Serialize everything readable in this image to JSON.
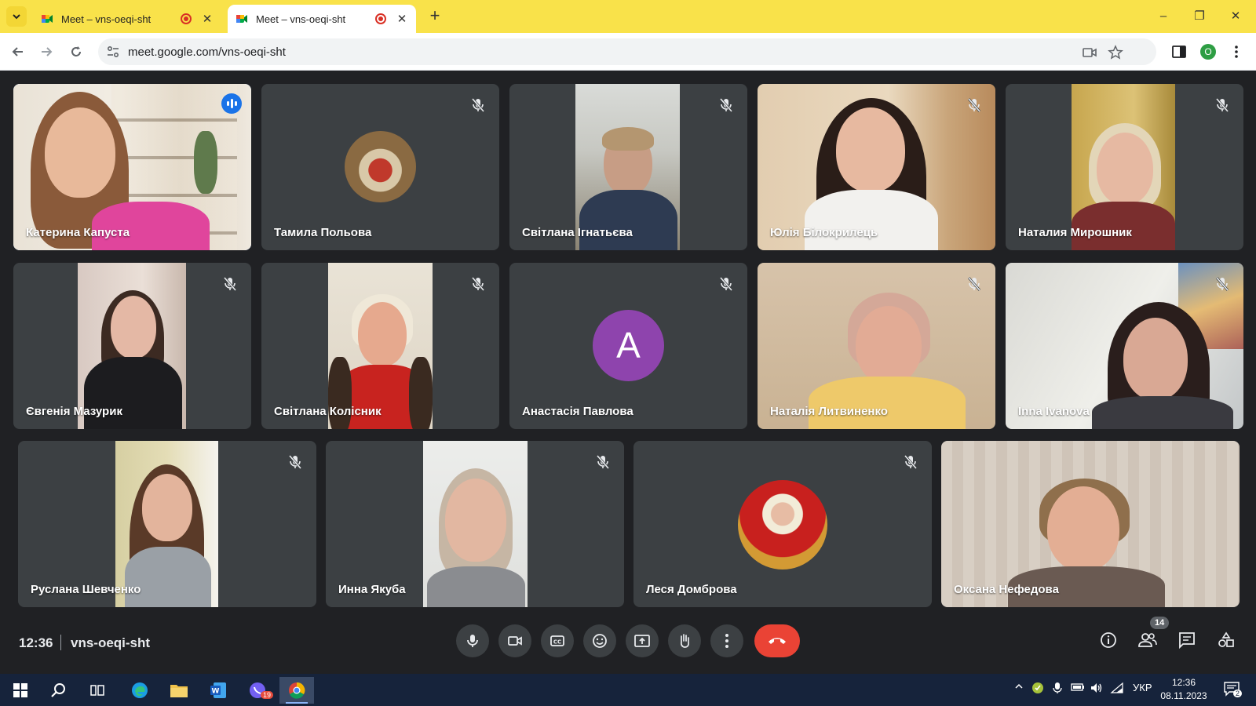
{
  "browser": {
    "tabs": [
      {
        "title": "Meet – vns-oeqi-sht",
        "close": "✕"
      },
      {
        "title": "Meet – vns-oeqi-sht",
        "close": "✕"
      }
    ],
    "new_tab": "+",
    "url": "meet.google.com/vns-oeqi-sht",
    "profile_initial": "O",
    "window_controls": {
      "minimize": "–",
      "restore": "❐",
      "close": "✕"
    },
    "tabbar_color": "#f9e24a"
  },
  "meet": {
    "participants": [
      {
        "name": "Катерина Капуста",
        "speaking": true,
        "muted": false
      },
      {
        "name": "Тамила Польова",
        "muted": true
      },
      {
        "name": "Світлана Ігнатьєва",
        "muted": true
      },
      {
        "name": "Юлія Білокрилець",
        "muted": true
      },
      {
        "name": "Наталия Мирошник",
        "muted": true
      },
      {
        "name": "Євгенія Мазурик",
        "muted": true
      },
      {
        "name": "Світлана Колісник",
        "muted": true
      },
      {
        "name": "Анастасія Павлова",
        "muted": true,
        "avatar_letter": "A"
      },
      {
        "name": "Наталія Литвиненко",
        "muted": true
      },
      {
        "name": "Inna Ivanova",
        "muted": true
      },
      {
        "name": "Руслана Шевченко",
        "muted": true
      },
      {
        "name": "Инна Якуба",
        "muted": true
      },
      {
        "name": "Леся Домброва",
        "muted": true
      },
      {
        "name": "Оксана Нефедова",
        "muted": false
      }
    ],
    "bottom_bar": {
      "time": "12:36",
      "meeting_code": "vns-oeqi-sht",
      "participant_count": "14"
    },
    "colors": {
      "accent": "#8ab4f8",
      "hangup": "#ea4335",
      "tile": "#3c4043",
      "avatar": "#8e44ad"
    }
  },
  "taskbar": {
    "language": "УКР",
    "time": "12:36",
    "date": "08.11.2023",
    "viber_badge": "19",
    "notification_count": "2"
  }
}
